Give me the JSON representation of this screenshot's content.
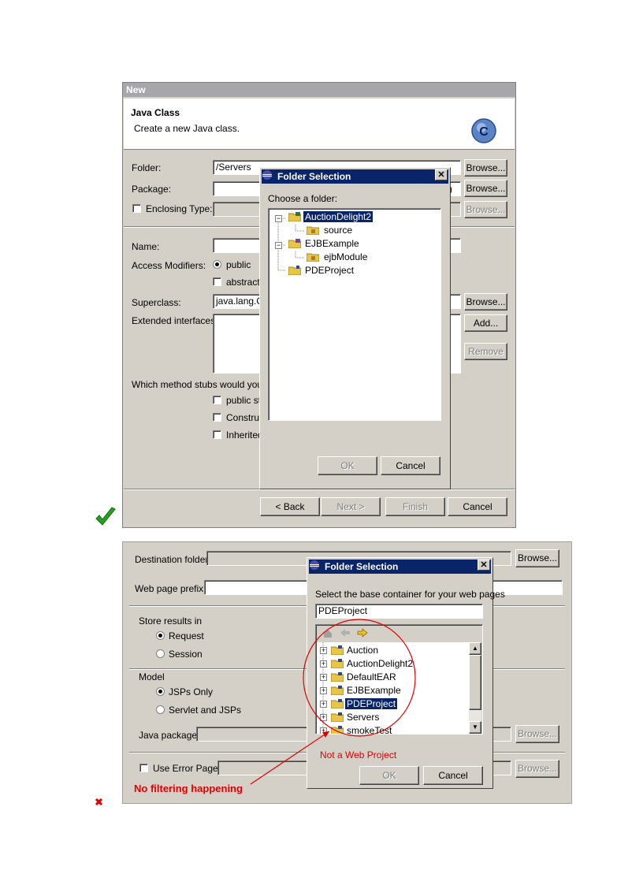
{
  "top": {
    "window_title": "New",
    "header_title": "Java Class",
    "header_subtitle": "Create a new Java class.",
    "folder_label": "Folder:",
    "folder_value": "/Servers",
    "package_label": "Package:",
    "package_hint": ")",
    "enclosing_label": "Enclosing Type:",
    "name_label": "Name:",
    "access_label": "Access Modifiers:",
    "public_label": "public",
    "abstract_label": "abstract",
    "superclass_label": "Superclass:",
    "superclass_value": "java.lang.O",
    "interfaces_label": "Extended interfaces:",
    "stubs_label": "Which method stubs would you lik",
    "stub_1": "public st",
    "stub_2": "Construc",
    "stub_3": "Inherited",
    "browse": "Browse...",
    "add": "Add...",
    "remove": "Remove",
    "back": "< Back",
    "next": "Next >",
    "finish": "Finish",
    "cancel": "Cancel",
    "dialog": {
      "title": "Folder Selection",
      "close": "✕",
      "prompt": "Choose a folder:",
      "nodes": [
        "AuctionDelight2",
        "source",
        "EJBExample",
        "ejbModule",
        "PDEProject"
      ],
      "ok": "OK",
      "cancel": "Cancel"
    }
  },
  "bottom": {
    "dest_label": "Destination folder",
    "prefix_label": "Web page prefix",
    "store_label": "Store results in",
    "request_label": "Request",
    "session_label": "Session",
    "model_label": "Model",
    "jsp_label": "JSPs Only",
    "servlet_label": "Servlet and JSPs",
    "javapkg_label": "Java package",
    "errpage_label": "Use Error Page:",
    "browse": "Browse...",
    "dialog": {
      "title": "Folder Selection",
      "close": "✕",
      "prompt": "Select the base container for your web pages",
      "value": "PDEProject",
      "nodes": [
        "Auction",
        "AuctionDelight2",
        "DefaultEAR",
        "EJBExample",
        "PDEProject",
        "Servers",
        "smokeTest"
      ],
      "ok": "OK",
      "cancel": "Cancel"
    },
    "annotation_not_web": "Not a Web Project",
    "annotation_no_filter": "No filtering happening"
  },
  "colors": {
    "accent": "#0a246a",
    "annotation": "#e00000",
    "check_ok": "#22a01e"
  }
}
